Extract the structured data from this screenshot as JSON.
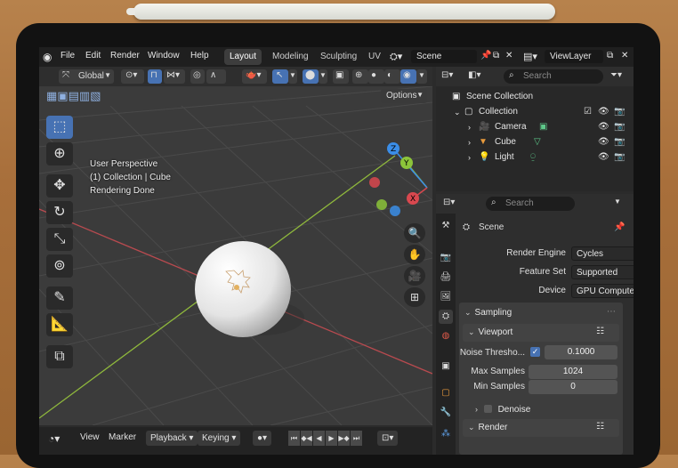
{
  "topbar": {
    "menus": [
      "File",
      "Edit",
      "Render",
      "Window",
      "Help"
    ],
    "workspaces": [
      "Layout",
      "Modeling",
      "Sculpting",
      "UV"
    ],
    "active_workspace": "Layout",
    "scene": "Scene",
    "view_layer": "ViewLayer"
  },
  "viewport": {
    "orientation": "Global",
    "options_label": "Options",
    "info": [
      "User Perspective",
      "(1) Collection | Cube",
      "Rendering Done"
    ]
  },
  "timeline": {
    "menus": [
      "View",
      "Marker"
    ],
    "playback": "Playback",
    "keying": "Keying"
  },
  "outliner": {
    "search_placeholder": "Search",
    "items": [
      {
        "label": "Scene Collection",
        "icon": "scene-collection-icon"
      },
      {
        "label": "Collection",
        "icon": "collection-icon"
      },
      {
        "label": "Camera",
        "icon": "camera-icon"
      },
      {
        "label": "Cube",
        "icon": "cube-icon"
      },
      {
        "label": "Light",
        "icon": "light-icon"
      }
    ]
  },
  "properties": {
    "search_placeholder": "Search",
    "context": "Scene",
    "render_engine_label": "Render Engine",
    "render_engine": "Cycles",
    "feature_set_label": "Feature Set",
    "feature_set": "Supported",
    "device_label": "Device",
    "device": "GPU Compute",
    "sampling": "Sampling",
    "viewport": "Viewport",
    "noise_threshold_label": "Noise Thresho...",
    "noise_threshold": "0.1000",
    "max_samples_label": "Max Samples",
    "max_samples": "1024",
    "min_samples_label": "Min Samples",
    "min_samples": "0",
    "denoise": "Denoise",
    "render": "Render"
  },
  "colors": {
    "accent": "#4772b3",
    "x_axis": "#d9484f",
    "y_axis": "#8cc43a",
    "z_axis": "#3b8ee8"
  }
}
